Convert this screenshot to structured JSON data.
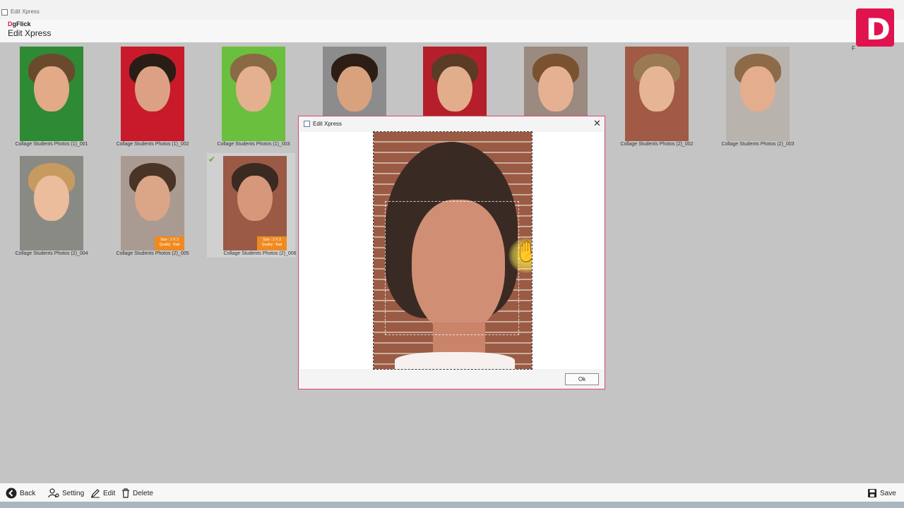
{
  "window": {
    "title": "Edit Xpress"
  },
  "app": {
    "logo_d": "D",
    "logo_rest": "gFlick",
    "title": "Edit Xpress"
  },
  "brand": {
    "letter": "D",
    "side_text": "F"
  },
  "thumbnails": [
    {
      "caption": "Collage Students Photos (1)_001",
      "bg": "#2f8a35",
      "skin": "#e2aa87",
      "hair": "#6a4a2c",
      "quality": null,
      "selected": false
    },
    {
      "caption": "Collage Students Photos (1)_002",
      "bg": "#c81a2a",
      "skin": "#dca185",
      "hair": "#2a1d16",
      "quality": null,
      "selected": false
    },
    {
      "caption": "Collage Students Photos (1)_003",
      "bg": "#6abf3f",
      "skin": "#e5b08f",
      "hair": "#8a6a45",
      "quality": null,
      "selected": false
    },
    {
      "caption": "",
      "bg": "#8c8c8c",
      "skin": "#d8a27f",
      "hair": "#2c1e15",
      "quality": null,
      "selected": false
    },
    {
      "caption": "",
      "bg": "#b51f2b",
      "skin": "#e1ad8a",
      "hair": "#5a3b25",
      "quality": null,
      "selected": false
    },
    {
      "caption": "",
      "bg": "#9a8a80",
      "skin": "#e5b192",
      "hair": "#7a5232",
      "quality": null,
      "selected": false
    },
    {
      "caption": "Collage Students Photos (2)_002",
      "bg": "#a05a45",
      "skin": "#e6b595",
      "hair": "#9a7a52",
      "quality": null,
      "selected": false
    },
    {
      "caption": "Collage Students Photos (2)_003",
      "bg": "#b9b3ad",
      "skin": "#e3ad8e",
      "hair": "#8d6a48",
      "quality": null,
      "selected": false
    },
    {
      "caption": "Collage Students Photos (2)_004",
      "bg": "#8a8a85",
      "skin": "#ebbd9c",
      "hair": "#c79b5f",
      "quality": null,
      "selected": false
    },
    {
      "caption": "Collage Students Photos (2)_005",
      "bg": "#a99a92",
      "skin": "#dba588",
      "hair": "#4a3426",
      "quality": {
        "line1": "Size : 2 X 3",
        "line2": "Quality : Bad"
      },
      "selected": false
    },
    {
      "caption": "Collage Students Photos (2)_006",
      "bg": "#9a5a45",
      "skin": "#d6977a",
      "hair": "#3a2a22",
      "quality": {
        "line1": "Size : 2 X 3",
        "line2": "Quality : Bad"
      },
      "selected": true
    }
  ],
  "dialog": {
    "title": "Edit Xpress",
    "close_glyph": "✕",
    "hand_glyph": "✋",
    "ok_label": "Ok"
  },
  "toolbar": {
    "back_label": "Back",
    "setting_label": "Setting",
    "edit_label": "Edit",
    "delete_label": "Delete",
    "save_label": "Save"
  },
  "colors": {
    "accent": "#e0134f",
    "quality_badge": "#f08a20",
    "check": "#5bb531"
  }
}
